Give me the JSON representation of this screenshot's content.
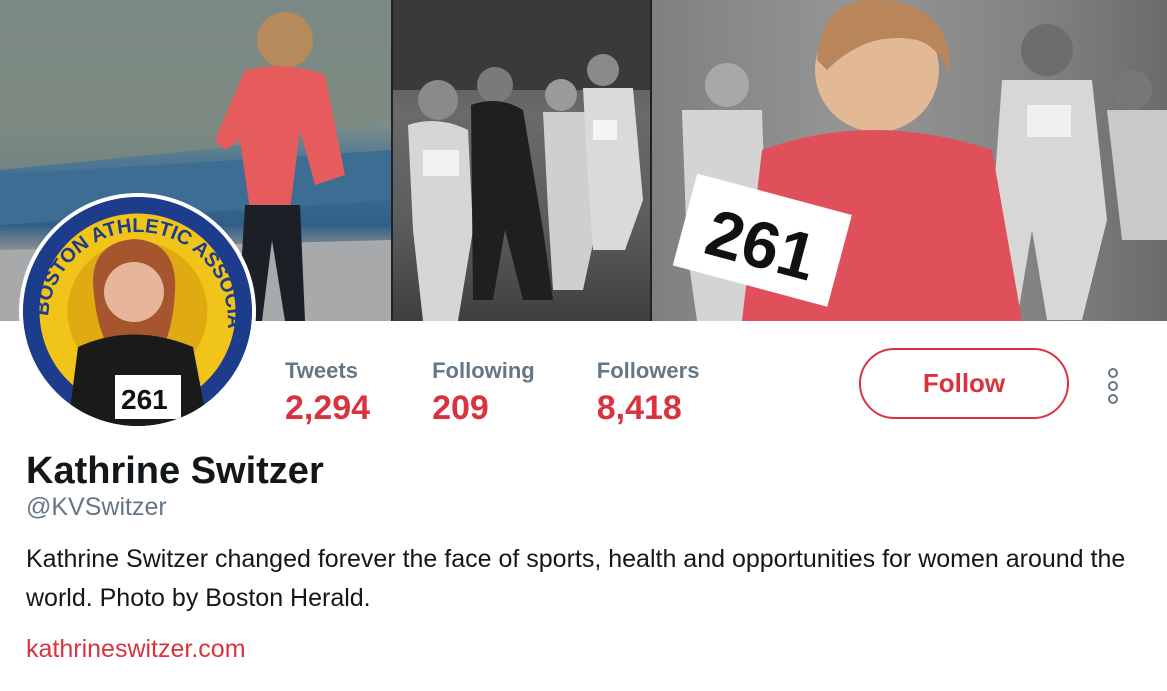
{
  "header": {
    "banner_image": "runner-collage-banner",
    "race_bib_number": "261"
  },
  "avatar": {
    "image": "profile-photo-boston-athletic-association",
    "seal_text": "BOSTON ATHLETIC ASSOCIATION",
    "bib_number": "261"
  },
  "stats": [
    {
      "label": "Tweets",
      "value": "2,294"
    },
    {
      "label": "Following",
      "value": "209"
    },
    {
      "label": "Followers",
      "value": "8,418"
    }
  ],
  "actions": {
    "follow_label": "Follow",
    "more_icon": "vertical-ellipsis-icon"
  },
  "profile": {
    "name": "Kathrine Switzer",
    "handle": "@KVSwitzer",
    "bio": "Kathrine Switzer changed forever the face of sports, health and opportunities for women around the world. Photo by Boston Herald.",
    "website": "kathrineswitzer.com"
  },
  "colors": {
    "accent": "#d9333f",
    "muted_text": "#657786",
    "primary_text": "#14171a"
  }
}
